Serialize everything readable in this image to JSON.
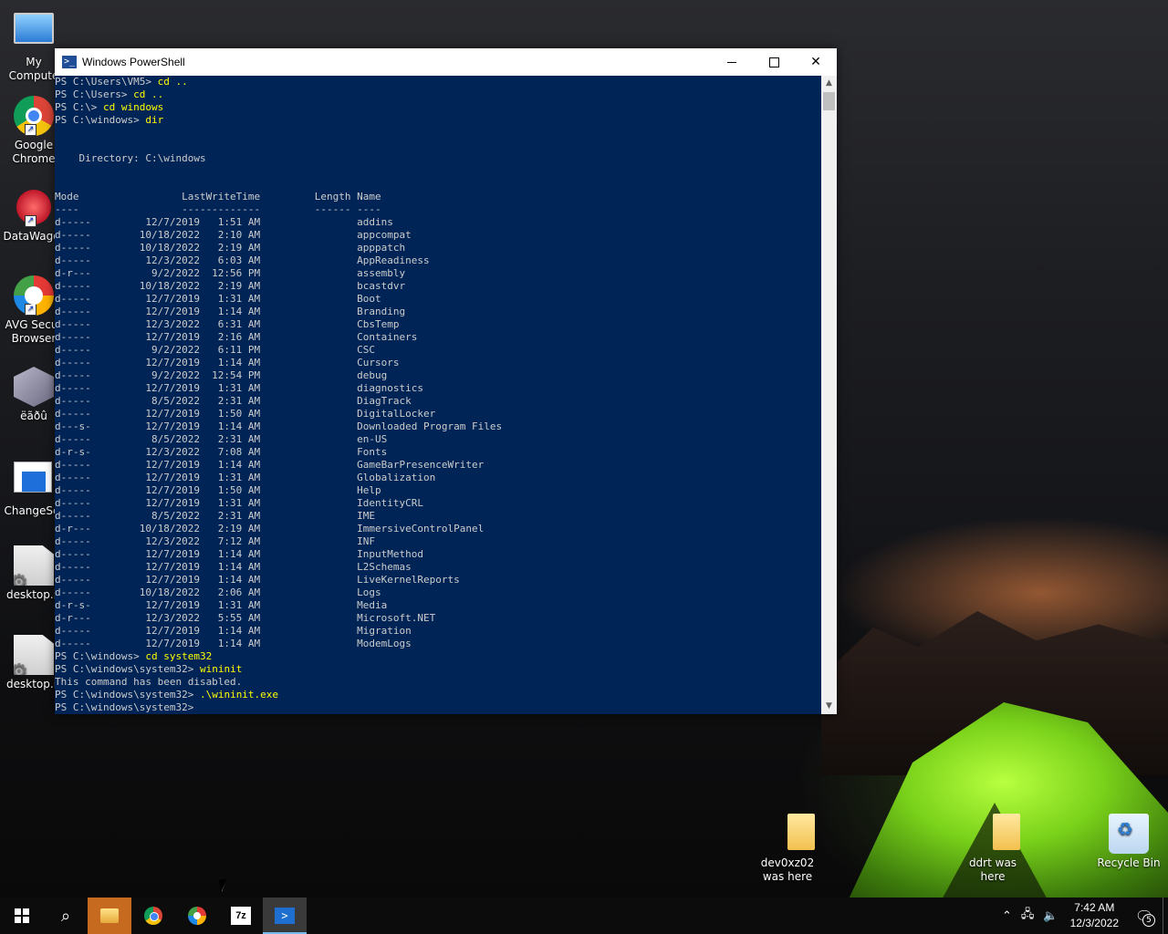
{
  "desktop": {
    "left_icons": [
      {
        "label": "My Compute",
        "icon": "my-computer-icon"
      },
      {
        "label": "Google Chrome",
        "icon": "chrome-icon"
      },
      {
        "label": "DataWagor",
        "icon": "datawagon-icon"
      },
      {
        "label": "AVG Secur Browser",
        "icon": "avg-browser-icon"
      },
      {
        "label": "ëãðû",
        "icon": "gamecube-icon"
      },
      {
        "label": "ChangeScr",
        "icon": "changescreen-icon"
      },
      {
        "label": "desktop.ir",
        "icon": "settings-file-icon"
      },
      {
        "label": "desktop.ir",
        "icon": "settings-file-icon"
      }
    ],
    "right_icons": [
      {
        "label": "dev0xz02 was here",
        "icon": "folder-icon"
      },
      {
        "label": "ddrt was here",
        "icon": "folder-icon"
      },
      {
        "label": "Recycle Bin",
        "icon": "recycle-bin-icon"
      }
    ]
  },
  "powershell": {
    "title": "Windows PowerShell",
    "lines": [
      {
        "prompt": "PS C:\\Users\\VM5> ",
        "cmd": "cd ..",
        "text": ""
      },
      {
        "prompt": "PS C:\\Users> ",
        "cmd": "cd ..",
        "text": ""
      },
      {
        "prompt": "PS C:\\> ",
        "cmd": "cd windows",
        "text": ""
      },
      {
        "prompt": "PS C:\\windows> ",
        "cmd": "dir",
        "text": ""
      },
      {
        "prompt": "",
        "cmd": "",
        "text": ""
      },
      {
        "prompt": "",
        "cmd": "",
        "text": ""
      },
      {
        "prompt": "",
        "cmd": "",
        "text": "    Directory: C:\\windows"
      },
      {
        "prompt": "",
        "cmd": "",
        "text": ""
      },
      {
        "prompt": "",
        "cmd": "",
        "text": ""
      },
      {
        "prompt": "",
        "cmd": "",
        "text": "Mode                 LastWriteTime         Length Name"
      },
      {
        "prompt": "",
        "cmd": "",
        "text": "----                 -------------         ------ ----"
      },
      {
        "prompt": "",
        "cmd": "",
        "text": "d-----         12/7/2019   1:51 AM                addins"
      },
      {
        "prompt": "",
        "cmd": "",
        "text": "d-----        10/18/2022   2:10 AM                appcompat"
      },
      {
        "prompt": "",
        "cmd": "",
        "text": "d-----        10/18/2022   2:19 AM                apppatch"
      },
      {
        "prompt": "",
        "cmd": "",
        "text": "d-----         12/3/2022   6:03 AM                AppReadiness"
      },
      {
        "prompt": "",
        "cmd": "",
        "text": "d-r---          9/2/2022  12:56 PM                assembly"
      },
      {
        "prompt": "",
        "cmd": "",
        "text": "d-----        10/18/2022   2:19 AM                bcastdvr"
      },
      {
        "prompt": "",
        "cmd": "",
        "text": "d-----         12/7/2019   1:31 AM                Boot"
      },
      {
        "prompt": "",
        "cmd": "",
        "text": "d-----         12/7/2019   1:14 AM                Branding"
      },
      {
        "prompt": "",
        "cmd": "",
        "text": "d-----         12/3/2022   6:31 AM                CbsTemp"
      },
      {
        "prompt": "",
        "cmd": "",
        "text": "d-----         12/7/2019   2:16 AM                Containers"
      },
      {
        "prompt": "",
        "cmd": "",
        "text": "d-----          9/2/2022   6:11 PM                CSC"
      },
      {
        "prompt": "",
        "cmd": "",
        "text": "d-----         12/7/2019   1:14 AM                Cursors"
      },
      {
        "prompt": "",
        "cmd": "",
        "text": "d-----          9/2/2022  12:54 PM                debug"
      },
      {
        "prompt": "",
        "cmd": "",
        "text": "d-----         12/7/2019   1:31 AM                diagnostics"
      },
      {
        "prompt": "",
        "cmd": "",
        "text": "d-----          8/5/2022   2:31 AM                DiagTrack"
      },
      {
        "prompt": "",
        "cmd": "",
        "text": "d-----         12/7/2019   1:50 AM                DigitalLocker"
      },
      {
        "prompt": "",
        "cmd": "",
        "text": "d---s-         12/7/2019   1:14 AM                Downloaded Program Files"
      },
      {
        "prompt": "",
        "cmd": "",
        "text": "d-----          8/5/2022   2:31 AM                en-US"
      },
      {
        "prompt": "",
        "cmd": "",
        "text": "d-r-s-         12/3/2022   7:08 AM                Fonts"
      },
      {
        "prompt": "",
        "cmd": "",
        "text": "d-----         12/7/2019   1:14 AM                GameBarPresenceWriter"
      },
      {
        "prompt": "",
        "cmd": "",
        "text": "d-----         12/7/2019   1:31 AM                Globalization"
      },
      {
        "prompt": "",
        "cmd": "",
        "text": "d-----         12/7/2019   1:50 AM                Help"
      },
      {
        "prompt": "",
        "cmd": "",
        "text": "d-----         12/7/2019   1:31 AM                IdentityCRL"
      },
      {
        "prompt": "",
        "cmd": "",
        "text": "d-----          8/5/2022   2:31 AM                IME"
      },
      {
        "prompt": "",
        "cmd": "",
        "text": "d-r---        10/18/2022   2:19 AM                ImmersiveControlPanel"
      },
      {
        "prompt": "",
        "cmd": "",
        "text": "d-----         12/3/2022   7:12 AM                INF"
      },
      {
        "prompt": "",
        "cmd": "",
        "text": "d-----         12/7/2019   1:14 AM                InputMethod"
      },
      {
        "prompt": "",
        "cmd": "",
        "text": "d-----         12/7/2019   1:14 AM                L2Schemas"
      },
      {
        "prompt": "",
        "cmd": "",
        "text": "d-----         12/7/2019   1:14 AM                LiveKernelReports"
      },
      {
        "prompt": "",
        "cmd": "",
        "text": "d-----        10/18/2022   2:06 AM                Logs"
      },
      {
        "prompt": "",
        "cmd": "",
        "text": "d-r-s-         12/7/2019   1:31 AM                Media"
      },
      {
        "prompt": "",
        "cmd": "",
        "text": "d-r---         12/3/2022   5:55 AM                Microsoft.NET"
      },
      {
        "prompt": "",
        "cmd": "",
        "text": "d-----         12/7/2019   1:14 AM                Migration"
      },
      {
        "prompt": "",
        "cmd": "",
        "text": "d-----         12/7/2019   1:14 AM                ModemLogs"
      },
      {
        "prompt": "PS C:\\windows> ",
        "cmd": "cd system32",
        "text": ""
      },
      {
        "prompt": "PS C:\\windows\\system32> ",
        "cmd": "wininit",
        "text": ""
      },
      {
        "prompt": "",
        "cmd": "",
        "text": "This command has been disabled."
      },
      {
        "prompt": "PS C:\\windows\\system32> ",
        "cmd": ".\\wininit.exe",
        "text": ""
      },
      {
        "prompt": "PS C:\\windows\\system32> ",
        "cmd": "",
        "text": ""
      }
    ]
  },
  "taskbar": {
    "apps": [
      "start-button",
      "search-button",
      "file-explorer",
      "chrome",
      "avg-browser",
      "7zip",
      "powershell"
    ],
    "clock_time": "7:42 AM",
    "clock_date": "12/3/2022",
    "notification_count": "5",
    "sevenzip_label": "7z"
  },
  "colors": {
    "console_bg": "#012456",
    "console_text": "#cccccc",
    "command_text": "#ffff00"
  }
}
